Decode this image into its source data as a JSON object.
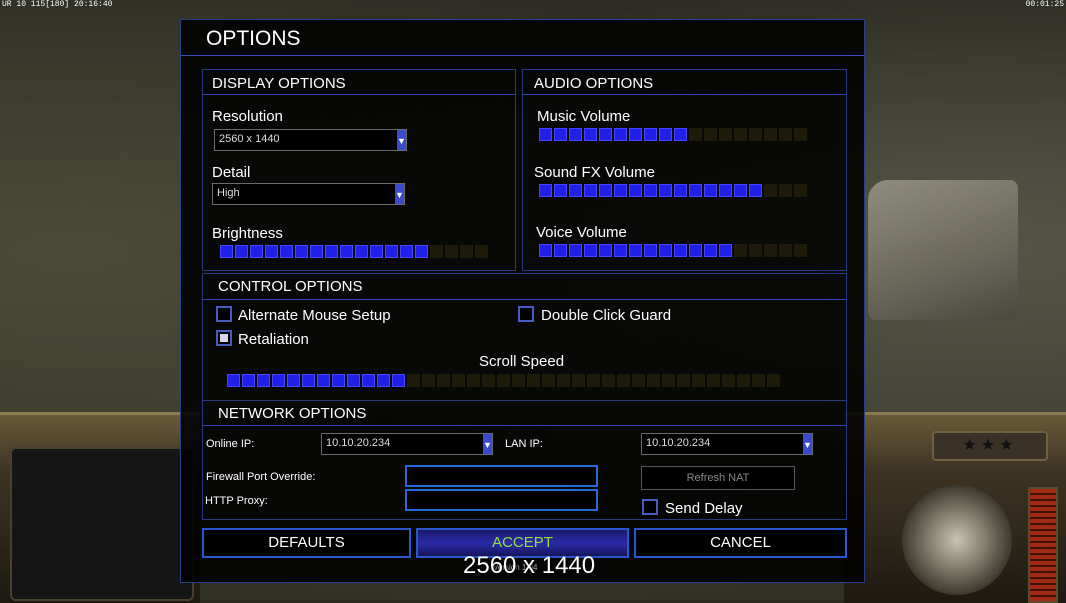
{
  "hud": {
    "top_left_status": "UR 10 115[180] 20:16:40",
    "top_right_timer": "00:01:25",
    "stars": "★★★"
  },
  "dialog": {
    "title": "OPTIONS",
    "overlay_text": "2560 x 1440",
    "version_label": "Version 1.04"
  },
  "display": {
    "title": "DISPLAY OPTIONS",
    "resolution_label": "Resolution",
    "resolution_value": "2560 x 1440",
    "detail_label": "Detail",
    "detail_value": "High",
    "brightness_label": "Brightness",
    "brightness_level": {
      "on": 14,
      "total": 18
    }
  },
  "audio": {
    "title": "AUDIO OPTIONS",
    "music_label": "Music Volume",
    "music_level": {
      "on": 10,
      "total": 18
    },
    "sfx_label": "Sound FX Volume",
    "sfx_level": {
      "on": 15,
      "total": 18
    },
    "voice_label": "Voice Volume",
    "voice_level": {
      "on": 13,
      "total": 18
    }
  },
  "control": {
    "title": "CONTROL OPTIONS",
    "alt_mouse_label": "Alternate Mouse Setup",
    "alt_mouse_checked": false,
    "double_click_label": "Double Click Guard",
    "double_click_checked": false,
    "retaliation_label": "Retaliation",
    "retaliation_checked": true,
    "scroll_label": "Scroll Speed",
    "scroll_level": {
      "on": 12,
      "total": 37
    }
  },
  "network": {
    "title": "NETWORK OPTIONS",
    "online_ip_label": "Online IP:",
    "online_ip_value": "10.10.20.234",
    "lan_ip_label": "LAN IP:",
    "lan_ip_value": "10.10.20.234",
    "firewall_label": "Firewall Port Override:",
    "firewall_value": "",
    "proxy_label": "HTTP Proxy:",
    "proxy_value": "",
    "refresh_nat_label": "Refresh NAT",
    "send_delay_label": "Send Delay",
    "send_delay_checked": false
  },
  "buttons": {
    "defaults": "DEFAULTS",
    "accept": "ACCEPT",
    "cancel": "CANCEL"
  },
  "colors": {
    "segment_on": "#2020e8",
    "segment_off": "#1e1a0a",
    "accent_border": "#2a56d0",
    "accept_text": "#8fe04a"
  }
}
